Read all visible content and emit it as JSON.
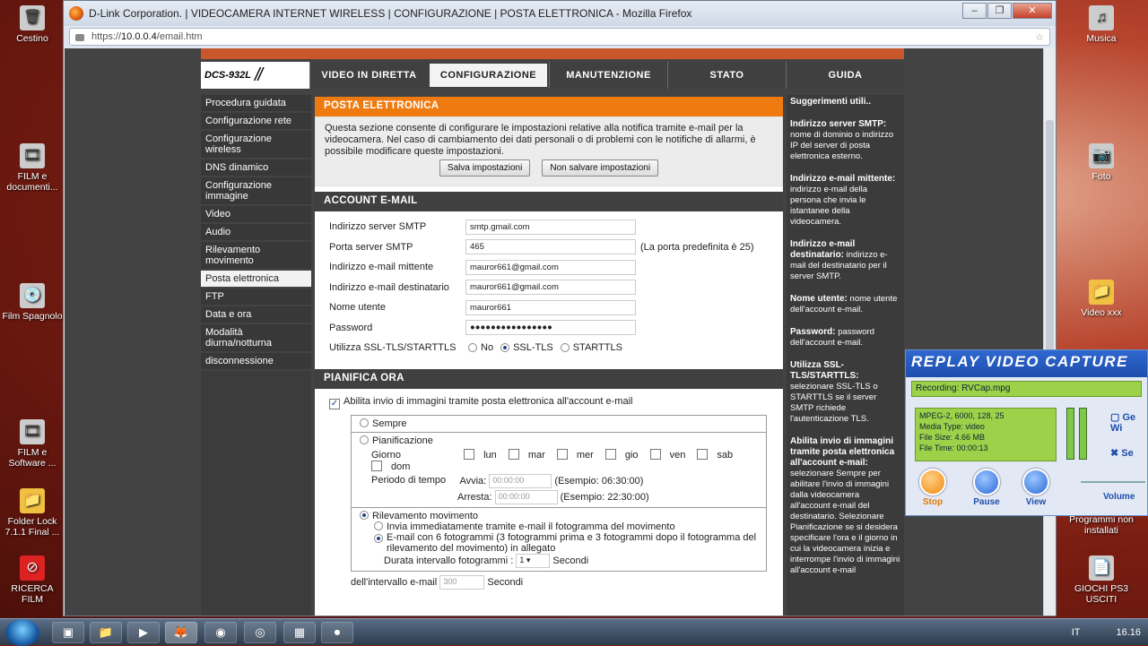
{
  "window": {
    "title": "D-Link Corporation. | VIDEOCAMERA INTERNET WIRELESS | CONFIGURAZIONE | POSTA ELETTRONICA - Mozilla Firefox",
    "url_prefix": "https://",
    "url_host": "10.0.0.4",
    "url_path": "/email.htm"
  },
  "desktop": {
    "icons": [
      "Cestino",
      "FILM e documenti...",
      "Film Spagnolo",
      "FILM e Software ...",
      "Folder Lock 7.1.1 Final ...",
      "RICERCA FILM",
      "Musica",
      "Foto",
      "Video xxx",
      "Programmi non installati",
      "GIOCHI PS3 USCITI"
    ]
  },
  "brand": {
    "model": "DCS-932L"
  },
  "nav": {
    "tabs": [
      "VIDEO IN DIRETTA",
      "CONFIGURAZIONE",
      "MANUTENZIONE",
      "STATO",
      "GUIDA"
    ]
  },
  "sidebar": {
    "items": [
      "Procedura guidata",
      "Configurazione rete",
      "Configurazione wireless",
      "DNS dinamico",
      "Configurazione immagine",
      "Video",
      "Audio",
      "Rilevamento movimento",
      "Posta elettronica",
      "FTP",
      "Data e ora",
      "Modalità diurna/notturna",
      "disconnessione"
    ]
  },
  "section1": {
    "title": "POSTA ELETTRONICA",
    "desc": "Questa sezione consente di configurare le impostazioni relative alla notifica tramite e-mail per la videocamera. Nel caso di cambiamento dei dati personali o di problemi con le notifiche di allarmi, è possibile modificare queste impostazioni.",
    "save": "Salva impostazioni",
    "nosave": "Non salvare impostazioni"
  },
  "account": {
    "title": "ACCOUNT E-MAIL",
    "fields": [
      {
        "label": "Indirizzo server SMTP",
        "value": "smtp.gmail.com"
      },
      {
        "label": "Porta server SMTP",
        "value": "465",
        "hint": "(La porta predefinita è 25)"
      },
      {
        "label": "Indirizzo e-mail mittente",
        "value": "mauror661@gmail.com"
      },
      {
        "label": "Indirizzo e-mail destinatario",
        "value": "mauror661@gmail.com"
      },
      {
        "label": "Nome utente",
        "value": "mauror661"
      },
      {
        "label": "Password",
        "value": "●●●●●●●●●●●●●●●●"
      }
    ],
    "ssl_label": "Utilizza SSL-TLS/STARTTLS",
    "ssl_options": [
      "No",
      "SSL-TLS",
      "STARTTLS"
    ]
  },
  "schedule": {
    "title": "PIANIFICA ORA",
    "enable": "Abilita invio di immagini tramite posta elettronica all'account e-mail",
    "sempre": "Sempre",
    "pianificazione": "Pianificazione",
    "giorno": "Giorno",
    "days": [
      "lun",
      "mar",
      "mer",
      "gio",
      "ven",
      "sab",
      "dom"
    ],
    "periodo": "Periodo di tempo",
    "avvia": "Avvia:",
    "arresta": "Arresta:",
    "time_placeholder": "00:00:00",
    "es1": "(Esempio: 06:30:00)",
    "es2": "(Esempio: 22:30:00)",
    "motion": "Rilevamento movimento",
    "opt1": "Invia immediatamente tramite e-mail il fotogramma del movimento",
    "opt2": "E-mail con 6 fotogrammi (3 fotogrammi prima e 3 fotogrammi dopo il fotogramma del rilevamento del movimento) in allegato",
    "interval_label": "Durata intervallo fotogrammi :",
    "interval_value": "1",
    "seconds": "Secondi",
    "email_interval_label": "dell'intervallo e-mail",
    "email_interval_value": "300"
  },
  "hints": {
    "title": "Suggerimenti utili..",
    "items": [
      {
        "h": "Indirizzo server SMTP:",
        "t": "nome di dominio o indirizzo IP del server di posta elettronica esterno."
      },
      {
        "h": "Indirizzo e-mail mittente:",
        "t": "indirizzo e-mail della persona che invia le istantanee della videocamera."
      },
      {
        "h": "Indirizzo e-mail destinatario:",
        "t": "indirizzo e-mail del destinatario per il server SMTP."
      },
      {
        "h": "Nome utente:",
        "t": "nome utente dell'account e-mail."
      },
      {
        "h": "Password:",
        "t": "password dell'account e-mail."
      },
      {
        "h": "Utilizza SSL-TLS/STARTTLS:",
        "t": "selezionare SSL-TLS o STARTTLS se il server SMTP richiede l'autenticazione TLS."
      },
      {
        "h": "Abilita invio di immagini tramite posta elettronica all'account e-mail:",
        "t": "selezionare Sempre per abilitare l'invio di immagini dalla videocamera all'account e-mail del destinatario. Selezionare Pianificazione se si desidera specificare l'ora e il giorno in cui la videocamera inizia e interrompe l'invio di immagini all'account e-mail"
      }
    ]
  },
  "rvc": {
    "title": "REPLAY VIDEO CAPTURE",
    "recording": "Recording: RVCap.mpg",
    "info": [
      "MPEG-2, 6000, 128, 25",
      "Media Type: video",
      "File Size: 4.66 MB",
      "File Time: 00:00:13"
    ],
    "side1": "Ge Wi",
    "side2": "Se",
    "volume": "Volume",
    "buttons": [
      "Stop",
      "Pause",
      "View"
    ]
  },
  "tray": {
    "lang": "IT",
    "time": "16.16"
  }
}
